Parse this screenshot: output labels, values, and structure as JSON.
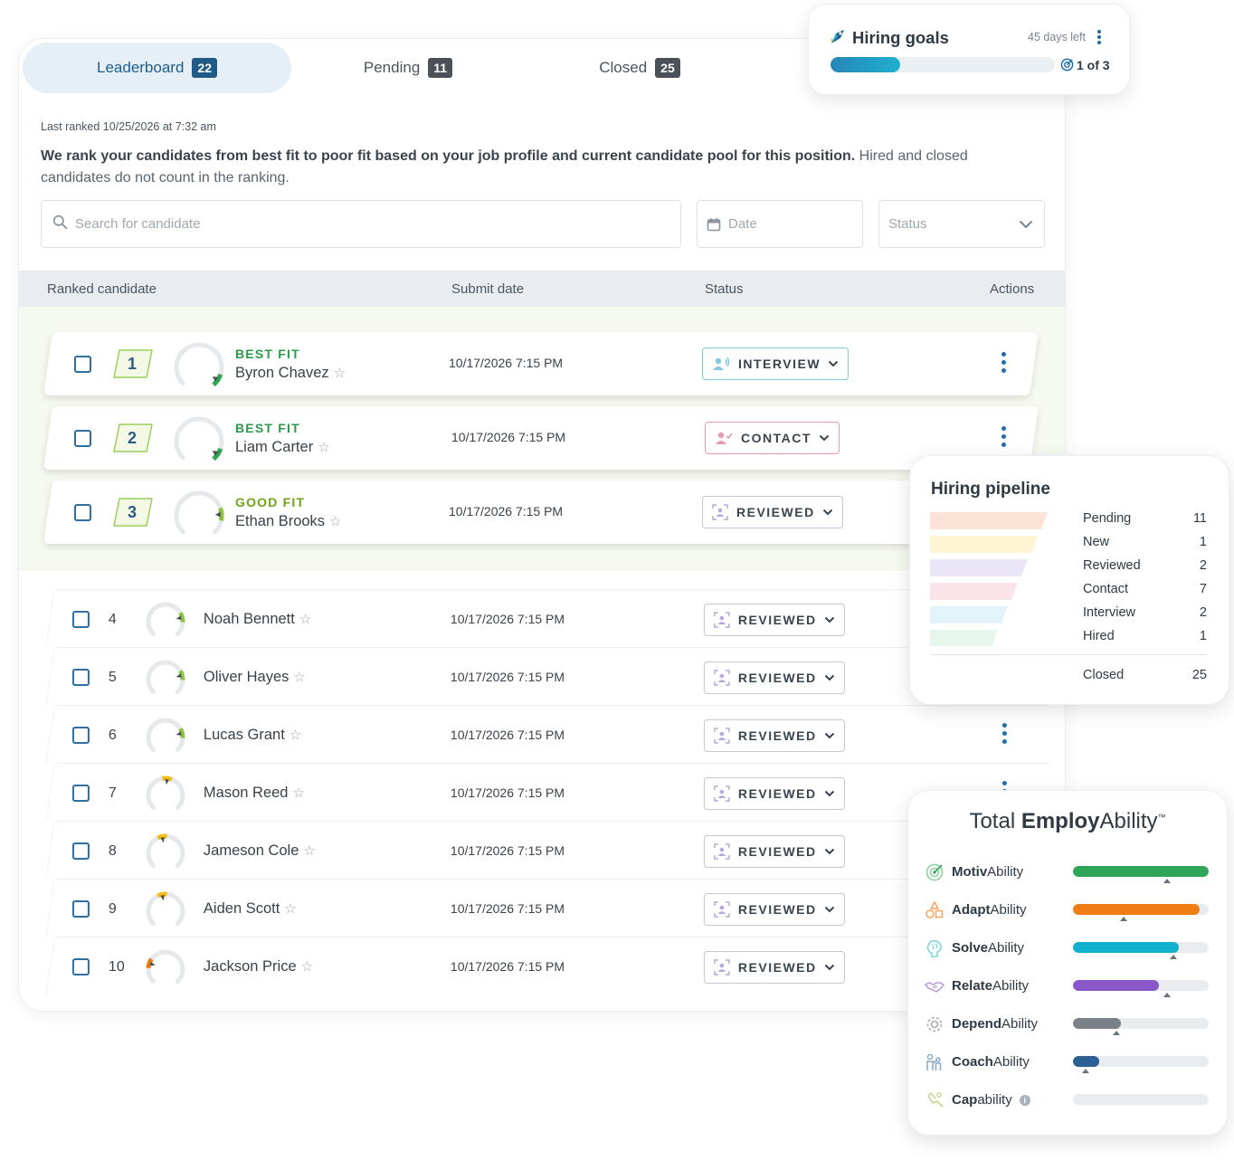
{
  "tabs": [
    {
      "label": "Leaderboard",
      "count": "22"
    },
    {
      "label": "Pending",
      "count": "11"
    },
    {
      "label": "Closed",
      "count": "25"
    }
  ],
  "last_ranked": "Last ranked 10/25/2026 at 7:32 am",
  "intro_bold": "We rank your candidates from best fit to poor fit based on your job profile and current candidate pool for this position.",
  "intro_rest": " Hired and closed candidates do not count in the ranking.",
  "search": {
    "placeholder": "Search for candidate"
  },
  "date_filter": {
    "placeholder": "Date"
  },
  "status_filter": {
    "placeholder": "Status"
  },
  "columns": [
    "Ranked candidate",
    "Submit date",
    "Status",
    "Actions"
  ],
  "top_candidates": [
    {
      "rank": "1",
      "fit": "BEST FIT",
      "name": "Byron Chavez",
      "date": "10/17/2026  7:15 PM",
      "status": "INTERVIEW"
    },
    {
      "rank": "2",
      "fit": "BEST FIT",
      "name": "Liam Carter",
      "date": "10/17/2026  7:15 PM",
      "status": "CONTACT"
    },
    {
      "rank": "3",
      "fit": "GOOD FIT",
      "name": "Ethan Brooks",
      "date": "10/17/2026  7:15 PM",
      "status": "REVIEWED"
    }
  ],
  "candidates": [
    {
      "rank": "4",
      "name": "Noah Bennett",
      "date": "10/17/2026  7:15 PM",
      "status": "REVIEWED"
    },
    {
      "rank": "5",
      "name": "Oliver Hayes",
      "date": "10/17/2026  7:15 PM",
      "status": "REVIEWED"
    },
    {
      "rank": "6",
      "name": "Lucas Grant",
      "date": "10/17/2026  7:15 PM",
      "status": "REVIEWED"
    },
    {
      "rank": "7",
      "name": "Mason Reed",
      "date": "10/17/2026  7:15 PM",
      "status": "REVIEWED"
    },
    {
      "rank": "8",
      "name": "Jameson Cole",
      "date": "10/17/2026  7:15 PM",
      "status": "REVIEWED"
    },
    {
      "rank": "9",
      "name": "Aiden Scott",
      "date": "10/17/2026  7:15 PM",
      "status": "REVIEWED"
    },
    {
      "rank": "10",
      "name": "Jackson Price",
      "date": "10/17/2026  7:15 PM",
      "status": "REVIEWED"
    }
  ],
  "hiring_goals": {
    "title": "Hiring goals",
    "days_left": "45 days left",
    "progress_label": "1 of 3",
    "progress_fraction": 0.31
  },
  "pipeline": {
    "title": "Hiring pipeline",
    "stages": [
      {
        "label": "Pending",
        "count": "11",
        "color": "#fde3d6"
      },
      {
        "label": "New",
        "count": "1",
        "color": "#fdf5d3"
      },
      {
        "label": "Reviewed",
        "count": "2",
        "color": "#ebe6f7"
      },
      {
        "label": "Contact",
        "count": "7",
        "color": "#fbe3ea"
      },
      {
        "label": "Interview",
        "count": "2",
        "color": "#e2f4fa"
      },
      {
        "label": "Hired",
        "count": "1",
        "color": "#e7f6ec"
      }
    ],
    "closed": {
      "label": "Closed",
      "count": "25"
    }
  },
  "employability": {
    "title_plain": "Total ",
    "title_bold": "Employ",
    "title_end": "Ability",
    "title_tm": "™",
    "rows": [
      {
        "bold": "Motiv",
        "rest": "Ability",
        "fill": 1.0,
        "marker": 0.69,
        "color": "#2fa55a",
        "icon": "target-icon"
      },
      {
        "bold": "Adapt",
        "rest": "Ability",
        "fill": 0.93,
        "marker": 0.37,
        "color": "#ef7d13",
        "icon": "shapes-icon"
      },
      {
        "bold": "Solve",
        "rest": "Ability",
        "fill": 0.78,
        "marker": 0.74,
        "color": "#12b1d0",
        "icon": "brain-icon"
      },
      {
        "bold": "Relate",
        "rest": "Ability",
        "fill": 0.63,
        "marker": 0.69,
        "color": "#8a57c8",
        "icon": "handshake-icon"
      },
      {
        "bold": "Depend",
        "rest": "Ability",
        "fill": 0.35,
        "marker": 0.32,
        "color": "#7b8188",
        "icon": "gear-icon"
      },
      {
        "bold": "Coach",
        "rest": "Ability",
        "fill": 0.19,
        "marker": 0.09,
        "color": "#2c5f93",
        "icon": "people-icon"
      },
      {
        "bold": "Cap",
        "rest": "ability",
        "fill": 0.0,
        "marker": null,
        "color": "#cfd5da",
        "icon": "hand-icon"
      }
    ]
  }
}
